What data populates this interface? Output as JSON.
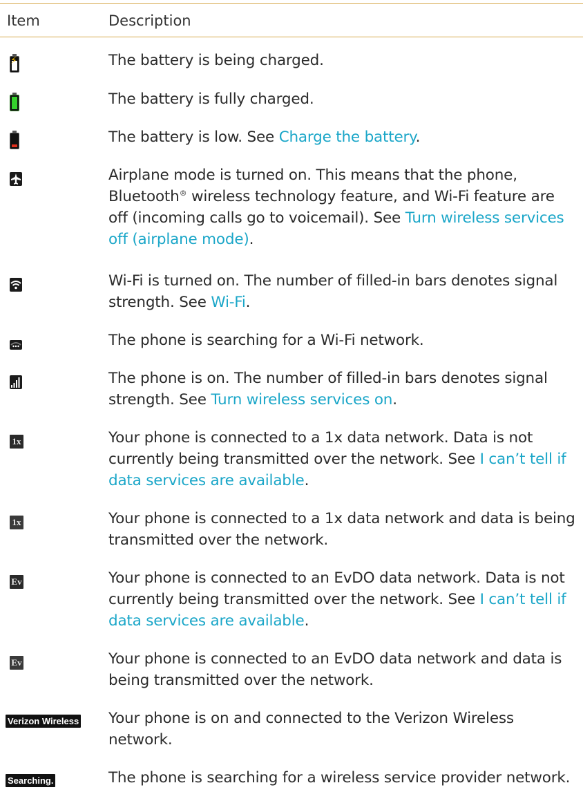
{
  "header": {
    "item": "Item",
    "description": "Description"
  },
  "colors": {
    "rule": "#d6a94a",
    "link": "#1aa6c8",
    "text": "#2b2b2b"
  },
  "rows": [
    {
      "icon": "battery-charging-icon",
      "text": [
        "The battery is being charged."
      ]
    },
    {
      "icon": "battery-full-icon",
      "text": [
        "The battery is fully charged."
      ]
    },
    {
      "icon": "battery-low-icon",
      "text": [
        "The battery is low. See ",
        "Charge the battery",
        "."
      ]
    },
    {
      "icon": "airplane-icon",
      "text": [
        "Airplane mode is turned on. This means that the phone, Bluetooth",
        "®",
        " wireless technology feature, and Wi-Fi feature are off (incoming calls go to voicemail). See ",
        "Turn wireless services off (airplane mode)",
        "."
      ]
    },
    {
      "icon": "wifi-icon",
      "text": [
        "Wi-Fi is turned on. The number of filled-in bars denotes signal strength. See ",
        "Wi-Fi",
        "."
      ]
    },
    {
      "icon": "wifi-searching-icon",
      "text": [
        "The phone is searching for a Wi-Fi network."
      ]
    },
    {
      "icon": "signal-bars-icon",
      "text": [
        "The phone is on. The number of filled-in bars denotes signal strength. See ",
        "Turn wireless services on",
        "."
      ]
    },
    {
      "icon": "1x-idle-icon",
      "badge": "1x",
      "text": [
        "Your phone is connected to a 1x data network. Data is not currently being transmitted over the network. See ",
        "I can’t tell if data services are available",
        "."
      ]
    },
    {
      "icon": "1x-active-icon",
      "badge": "1x",
      "text": [
        "Your phone is connected to a 1x data network and data is being transmitted over the network."
      ]
    },
    {
      "icon": "evdo-idle-icon",
      "badge": "Ev",
      "text": [
        "Your phone is connected to an EvDO data network. Data is not currently being transmitted over the network. See ",
        "I can’t tell if data services are available",
        "."
      ]
    },
    {
      "icon": "evdo-active-icon",
      "badge": "Ev",
      "text": [
        "Your phone is connected to an EvDO data network and data is being transmitted over the network."
      ]
    },
    {
      "icon": "carrier-name-icon",
      "badge": "Verizon Wireless",
      "text": [
        "Your phone is on and connected to the Verizon Wireless network."
      ]
    },
    {
      "icon": "searching-provider-icon",
      "badge": "Searching.",
      "text": [
        "The phone is searching for a wireless service provider network."
      ]
    }
  ]
}
